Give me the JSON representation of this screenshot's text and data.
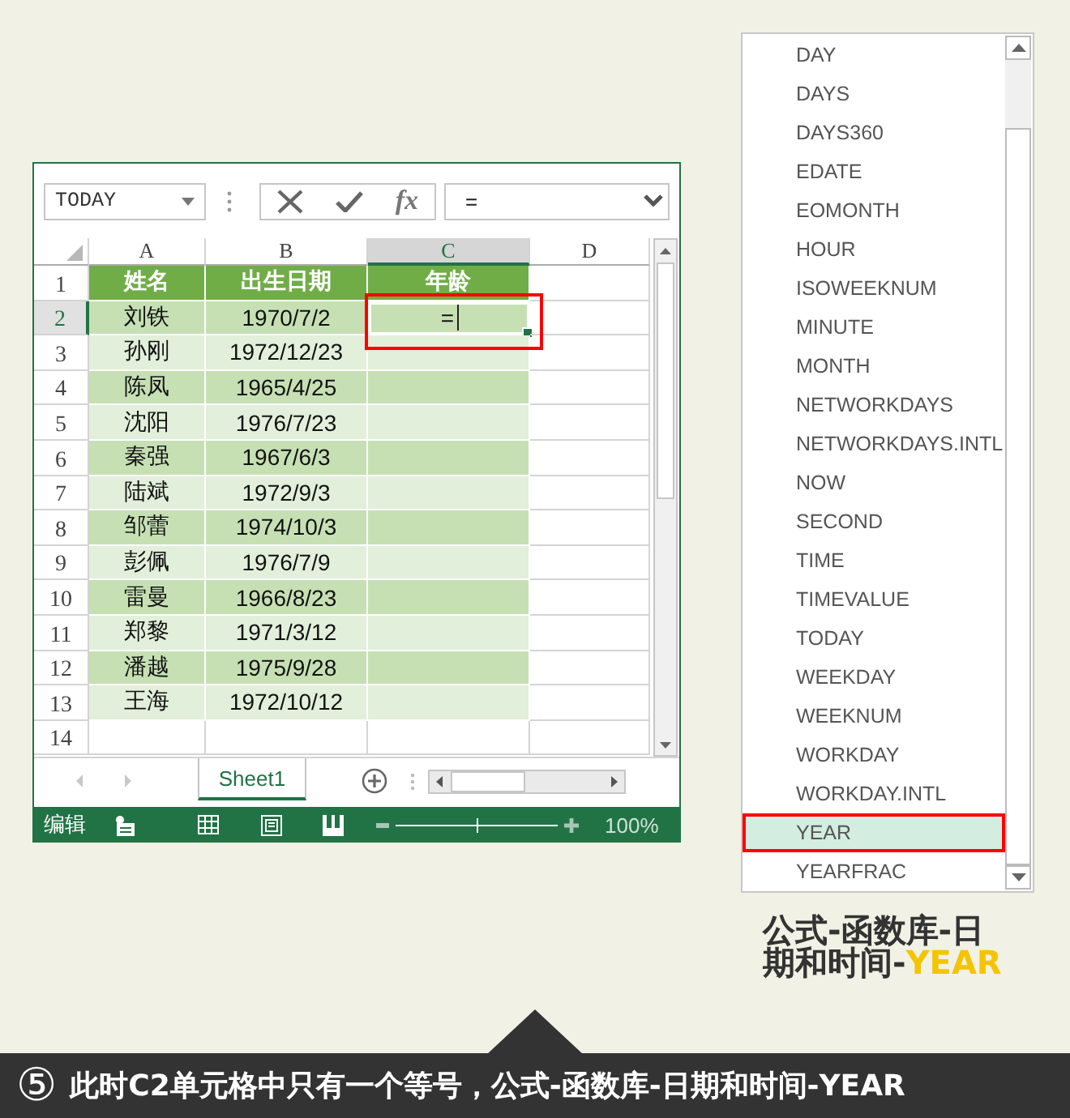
{
  "excel": {
    "name_box": "TODAY",
    "function_button": "fx",
    "formula": "=",
    "columns": [
      {
        "label": "A",
        "selected": false
      },
      {
        "label": "B",
        "selected": false
      },
      {
        "label": "C",
        "selected": true
      },
      {
        "label": "D",
        "selected": false
      }
    ],
    "rows": [
      {
        "number": "1",
        "kind": "header",
        "selected": false,
        "cells": [
          "姓名",
          "出生日期",
          "年龄"
        ]
      },
      {
        "number": "2",
        "kind": "data",
        "selected": true,
        "cells": [
          "刘铁",
          "1970/7/2",
          "="
        ]
      },
      {
        "number": "3",
        "kind": "data",
        "selected": false,
        "cells": [
          "孙刚",
          "1972/12/23"
        ]
      },
      {
        "number": "4",
        "kind": "data",
        "selected": false,
        "cells": [
          "陈凤",
          "1965/4/25"
        ]
      },
      {
        "number": "5",
        "kind": "data",
        "selected": false,
        "cells": [
          "沈阳",
          "1976/7/23"
        ]
      },
      {
        "number": "6",
        "kind": "data",
        "selected": false,
        "cells": [
          "秦强",
          "1967/6/3"
        ]
      },
      {
        "number": "7",
        "kind": "data",
        "selected": false,
        "cells": [
          "陆斌",
          "1972/9/3"
        ]
      },
      {
        "number": "8",
        "kind": "data",
        "selected": false,
        "cells": [
          "邹蕾",
          "1974/10/3"
        ]
      },
      {
        "number": "9",
        "kind": "data",
        "selected": false,
        "cells": [
          "彭佩",
          "1976/7/9"
        ]
      },
      {
        "number": "10",
        "kind": "data",
        "selected": false,
        "cells": [
          "雷曼",
          "1966/8/23"
        ]
      },
      {
        "number": "11",
        "kind": "data",
        "selected": false,
        "cells": [
          "郑黎",
          "1971/3/12"
        ]
      },
      {
        "number": "12",
        "kind": "data",
        "selected": false,
        "cells": [
          "潘越",
          "1975/9/28"
        ]
      },
      {
        "number": "13",
        "kind": "data",
        "selected": false,
        "cells": [
          "王海",
          "1972/10/12"
        ]
      },
      {
        "number": "14",
        "kind": "empty",
        "selected": false
      }
    ],
    "sheet_tabs": [
      {
        "label": "Sheet1",
        "selected": true
      }
    ],
    "status": "编辑",
    "zoom": {
      "level": 0.5,
      "reading": "100%"
    }
  },
  "function_list": {
    "items": [
      {
        "label": "DAY",
        "selected": false
      },
      {
        "label": "DAYS",
        "selected": false
      },
      {
        "label": "DAYS360",
        "selected": false
      },
      {
        "label": "EDATE",
        "selected": false
      },
      {
        "label": "EOMONTH",
        "selected": false
      },
      {
        "label": "HOUR",
        "selected": false
      },
      {
        "label": "ISOWEEKNUM",
        "selected": false
      },
      {
        "label": "MINUTE",
        "selected": false
      },
      {
        "label": "MONTH",
        "selected": false
      },
      {
        "label": "NETWORKDAYS",
        "selected": false
      },
      {
        "label": "NETWORKDAYS.INTL",
        "selected": false
      },
      {
        "label": "NOW",
        "selected": false
      },
      {
        "label": "SECOND",
        "selected": false
      },
      {
        "label": "TIME",
        "selected": false
      },
      {
        "label": "TIMEVALUE",
        "selected": false
      },
      {
        "label": "TODAY",
        "selected": false
      },
      {
        "label": "WEEKDAY",
        "selected": false
      },
      {
        "label": "WEEKNUM",
        "selected": false
      },
      {
        "label": "WORKDAY",
        "selected": false
      },
      {
        "label": "WORKDAY.INTL",
        "selected": false
      },
      {
        "label": "YEAR",
        "selected": true
      },
      {
        "label": "YEARFRAC",
        "selected": false
      }
    ]
  },
  "caption": {
    "text": "公式-函数库-日期和时间-",
    "highlight": "YEAR"
  },
  "footer": {
    "step": "⑤",
    "text": "此时C2单元格中只有一个等号，公式-函数库-日期和时间-YEAR"
  }
}
